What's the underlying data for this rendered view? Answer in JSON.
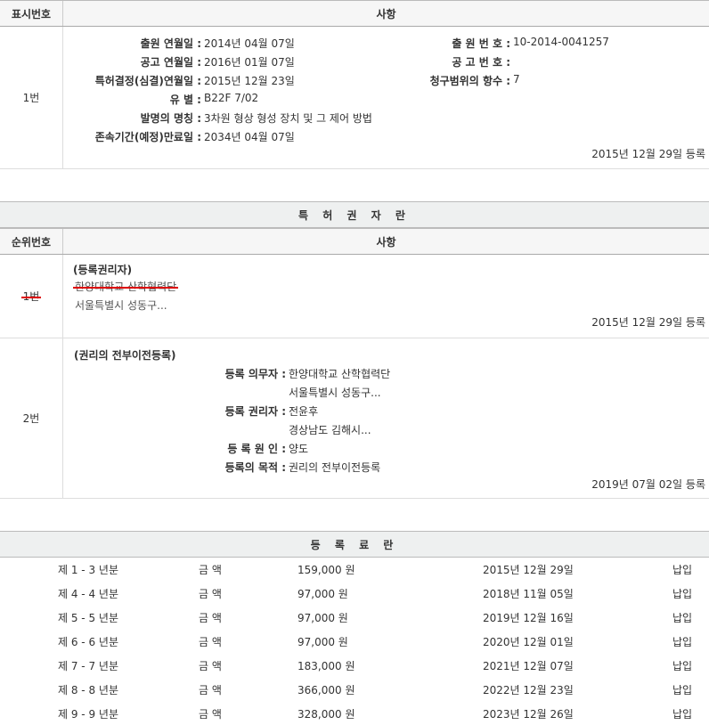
{
  "table1": {
    "header": {
      "col1": "표시번호",
      "col2": "사항"
    },
    "row": {
      "num": "1번",
      "fields_left": [
        {
          "label": "출원 연월일 :",
          "value": "2014년 04월 07일"
        },
        {
          "label": "공고 연월일 :",
          "value": "2016년 01월 07일"
        },
        {
          "label": "특허결정(심결)연월일 :",
          "value": "2015년 12월 23일"
        },
        {
          "label": "유 별 :",
          "value": "B22F 7/02"
        },
        {
          "label": "발명의 명칭 :",
          "value": "3차원 형상 형성 장치 및 그 제어 방법"
        },
        {
          "label": "존속기간(예정)만료일 :",
          "value": "2034년 04월 07일"
        }
      ],
      "fields_right": [
        {
          "label": "출 원 번 호 :",
          "value": "10-2014-0041257"
        },
        {
          "label": "공 고 번 호 :",
          "value": ""
        },
        {
          "label": "청구범위의 항수 :",
          "value": "7"
        }
      ],
      "date": "2015년 12월 29일 등록"
    }
  },
  "section2": {
    "title": "특 허 권 자 란",
    "header": {
      "col1": "순위번호",
      "col2": "사항"
    },
    "row1": {
      "num": "1번",
      "title": "(등록권리자)",
      "name": "한양대학교 산학협력단",
      "address": "서울특별시 성동구...",
      "date": "2015년 12월 29일 등록"
    },
    "row2": {
      "num": "2번",
      "title": "(권리의 전부이전등록)",
      "obligor_label": "등록 의무자 :",
      "obligor_name": "한양대학교 산학협력단",
      "obligor_address": "서울특별시 성동구...",
      "holder_label": "등록 권리자 :",
      "holder_name": "전윤후",
      "holder_address": "경상남도 김해시...",
      "cause_label": "등 록 원 인 :",
      "cause_value": "양도",
      "purpose_label": "등록의 목적 :",
      "purpose_value": "권리의 전부이전등록",
      "date": "2019년 07월 02일 등록"
    }
  },
  "section3": {
    "title": "등 록 료 란",
    "fees": [
      {
        "period": "제 1 - 3 년분",
        "label": "금 액",
        "amount": "159,000 원",
        "date": "2015년 12월 29일",
        "status": "납입"
      },
      {
        "period": "제 4 - 4 년분",
        "label": "금 액",
        "amount": "97,000 원",
        "date": "2018년 11월 05일",
        "status": "납입"
      },
      {
        "period": "제 5 - 5 년분",
        "label": "금 액",
        "amount": "97,000 원",
        "date": "2019년 12월 16일",
        "status": "납입"
      },
      {
        "period": "제 6 - 6 년분",
        "label": "금 액",
        "amount": "97,000 원",
        "date": "2020년 12월 01일",
        "status": "납입"
      },
      {
        "period": "제 7 - 7 년분",
        "label": "금 액",
        "amount": "183,000 원",
        "date": "2021년 12월 07일",
        "status": "납입"
      },
      {
        "period": "제 8 - 8 년분",
        "label": "금 액",
        "amount": "366,000 원",
        "date": "2022년 12월 23일",
        "status": "납입"
      },
      {
        "period": "제 9 - 9 년분",
        "label": "금 액",
        "amount": "328,000 원",
        "date": "2023년 12월 26일",
        "status": "납입"
      }
    ]
  }
}
